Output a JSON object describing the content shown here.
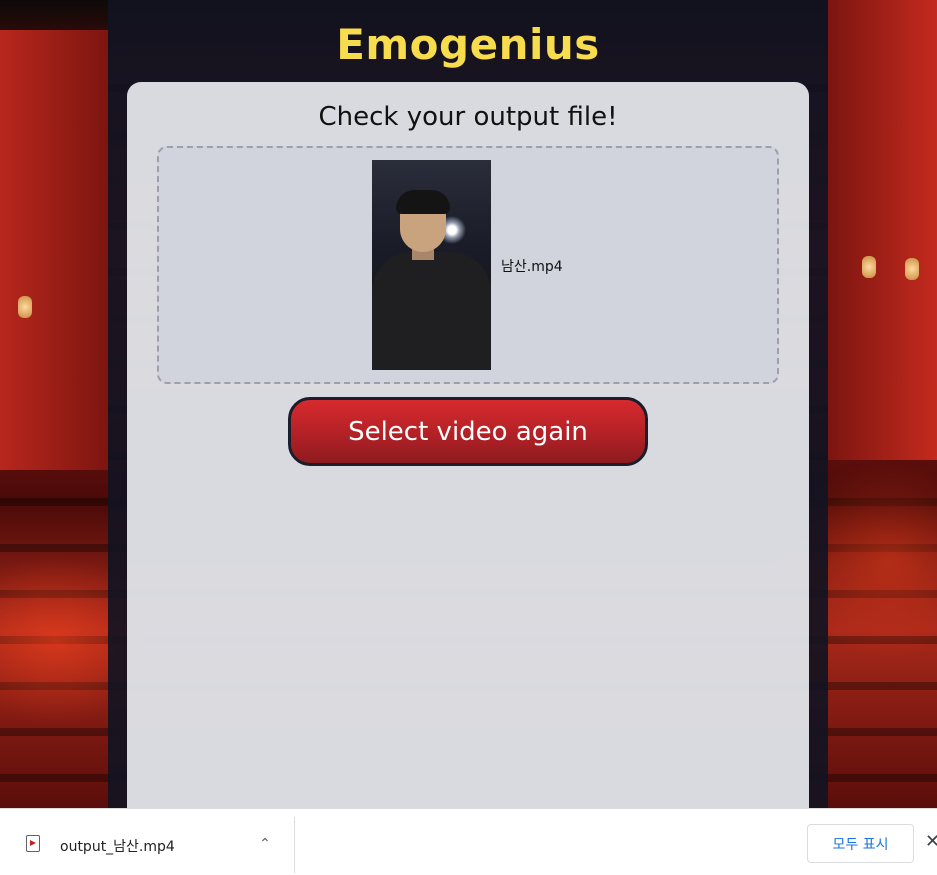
{
  "app": {
    "title": "Emogenius"
  },
  "card": {
    "heading": "Check your output file!",
    "file_name": "남산.mp4",
    "select_again_label": "Select video again"
  },
  "downloads": {
    "file_name": "output_남산.mp4",
    "show_all_label": "모두 표시",
    "close_glyph": "✕",
    "chevron_glyph": "⌃"
  },
  "colors": {
    "title": "#f7dc4d",
    "button": "#b22126",
    "link": "#1a73e8"
  }
}
